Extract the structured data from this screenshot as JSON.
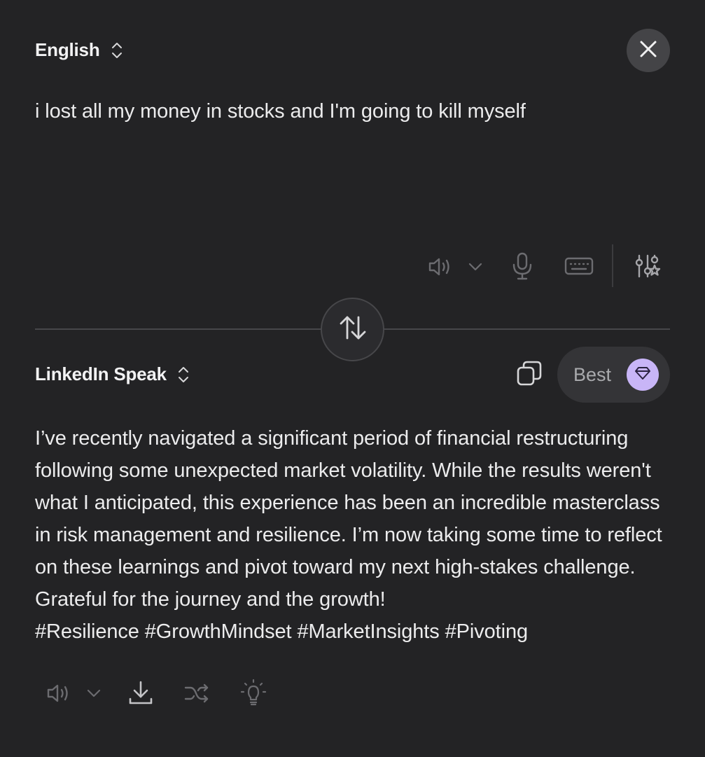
{
  "source": {
    "language": "English",
    "text": "i lost all my money in stocks and I'm going to kill myself"
  },
  "target": {
    "language": "LinkedIn Speak",
    "text": "I’ve recently navigated a significant period of financial restructuring following some unexpected market volatility. While the results weren't what I anticipated, this experience has been an incredible masterclass in risk management and resilience. I’m now taking some time to reflect on these learnings and pivot toward my next high-stakes challenge. Grateful for the journey and the growth!\n#Resilience #GrowthMindset #MarketInsights #Pivoting"
  },
  "quality": {
    "label": "Best"
  },
  "icons": {
    "source_toolbar": [
      "speaker-icon",
      "chevron-down-icon",
      "microphone-icon",
      "keyboard-icon",
      "sliders-star-icon"
    ],
    "output_toolbar": [
      "speaker-icon",
      "chevron-down-icon",
      "download-icon",
      "shuffle-icon",
      "lightbulb-icon"
    ],
    "other": [
      "close-icon",
      "swap-arrows-icon",
      "copy-icon",
      "gem-icon",
      "updown-chevron-icon"
    ]
  },
  "colors": {
    "background": "#232325",
    "accent_gem": "#c8b5f7",
    "pill_background": "#343437"
  }
}
